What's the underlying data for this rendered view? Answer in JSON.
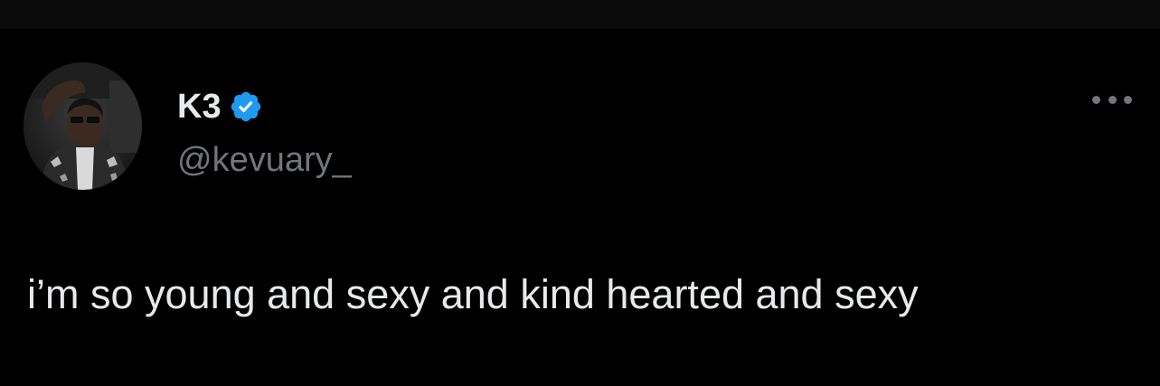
{
  "tweet": {
    "author": {
      "display_name": "K3",
      "handle": "@kevuary_",
      "verified": true,
      "verified_icon": "verified-badge-icon",
      "avatar_icon": "profile-photo"
    },
    "text": "i’m so young and sexy and kind hearted and sexy",
    "more_icon": "more-options-icon"
  },
  "colors": {
    "background": "#000000",
    "primary_text": "#e7e9ea",
    "secondary_text": "#71767b",
    "verified_blue": "#1d9bf0"
  }
}
